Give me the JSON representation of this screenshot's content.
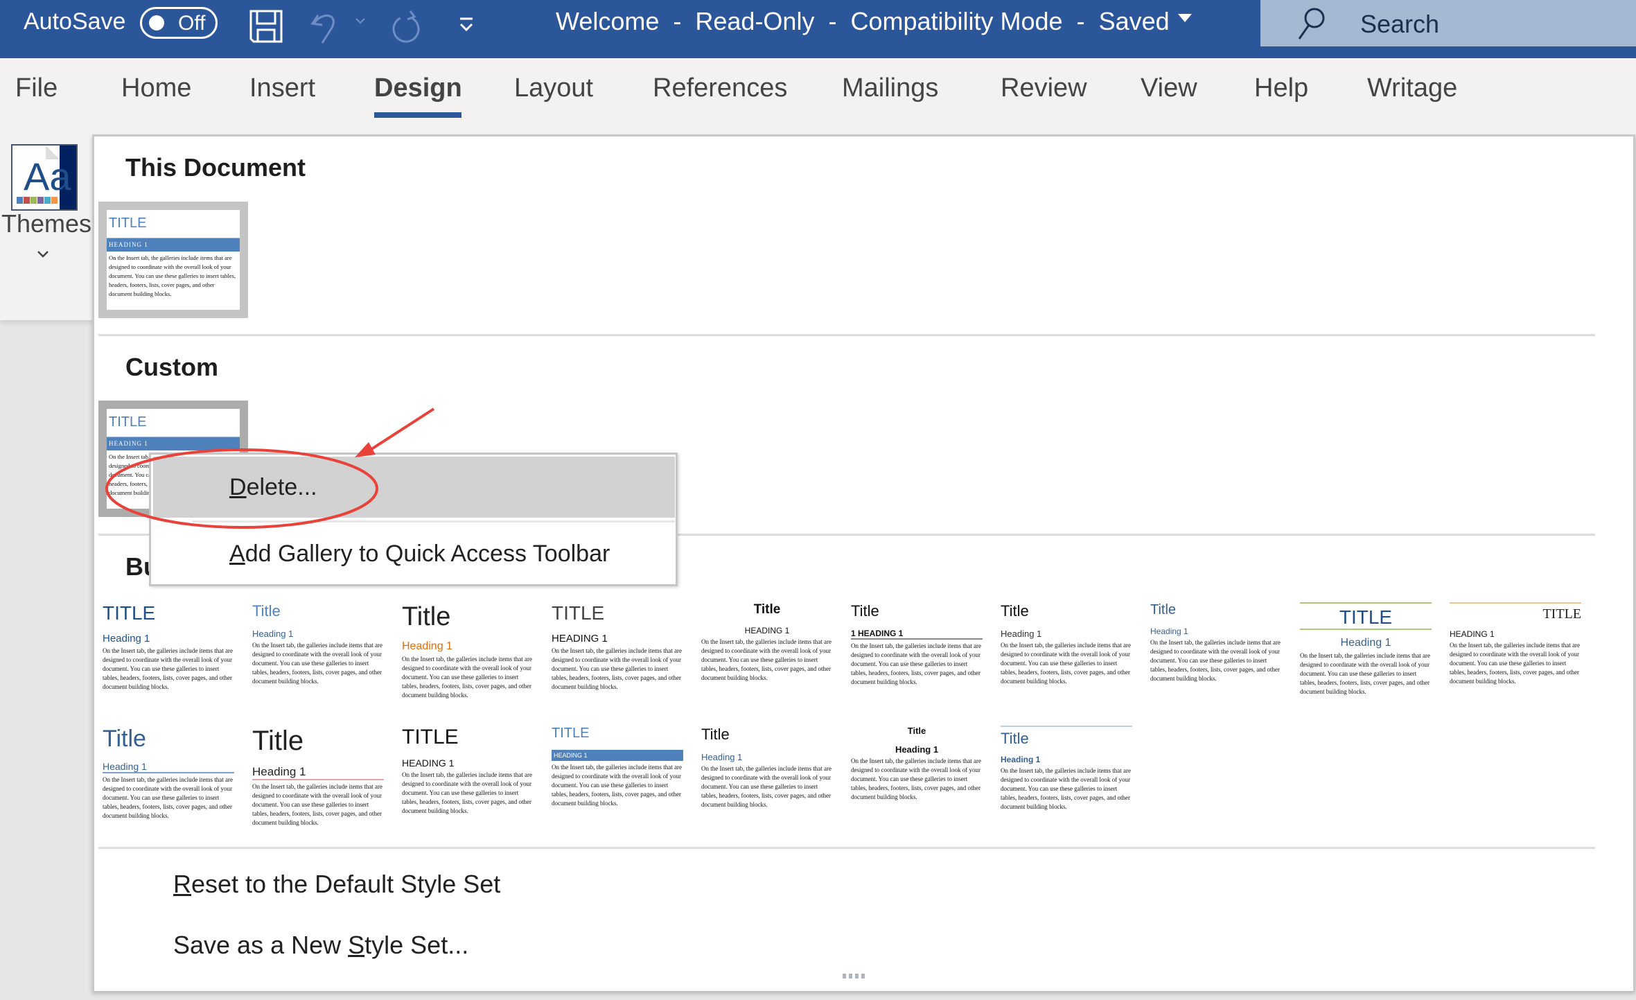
{
  "titlebar": {
    "autosave_label": "AutoSave",
    "autosave_state": "Off",
    "doc_title": "Welcome  -  Read-Only  -  Compatibility Mode  -  Saved",
    "search_placeholder": "Search",
    "colors": {
      "bar": "#2b579a",
      "search_bg": "#a6b9d3"
    }
  },
  "ribbon": {
    "tabs": [
      {
        "label": "File"
      },
      {
        "label": "Home"
      },
      {
        "label": "Insert"
      },
      {
        "label": "Design",
        "active": true
      },
      {
        "label": "Layout"
      },
      {
        "label": "References"
      },
      {
        "label": "Mailings"
      },
      {
        "label": "Review"
      },
      {
        "label": "View"
      },
      {
        "label": "Help"
      },
      {
        "label": "Writage"
      }
    ],
    "themes_label": "Themes",
    "theme_swatches": [
      "#4f81bd",
      "#c0504d",
      "#9bbb59",
      "#8064a2",
      "#4bacc6",
      "#f79646"
    ]
  },
  "gallery": {
    "this_document": {
      "title": "This Document",
      "thumb": {
        "title": "TITLE",
        "heading": "HEADING 1",
        "body": "On the Insert tab, the galleries include items that are designed to coordinate with the overall look of your document. You can use these galleries to insert tables, headers, footers, lists, cover pages, and other document building blocks."
      }
    },
    "custom": {
      "title": "Custom",
      "thumb": {
        "title": "TITLE",
        "heading": "HEADING 1",
        "body": "On the Insert tab, the galleries include items that are designed to coordinate with the overall look of your document. You can use these galleries to insert tables, headers, footers, lists, cover pages, and other document building blocks."
      }
    },
    "built_in": {
      "title": "Built-In",
      "body_text": "On the Insert tab, the galleries include items that are designed to coordinate with the overall look of your document. You can use these galleries to insert tables, headers, footers, lists, cover pages, and other document building blocks.",
      "row1": [
        {
          "title": "TITLE",
          "heading": "Heading 1"
        },
        {
          "title": "Title",
          "heading": "Heading 1"
        },
        {
          "title": "Title",
          "heading": "Heading 1"
        },
        {
          "title": "TITLE",
          "heading": "HEADING 1"
        },
        {
          "title": "Title",
          "heading": "HEADING 1"
        },
        {
          "title": "Title",
          "heading": "1   HEADING 1"
        },
        {
          "title": "Title",
          "heading": "Heading 1"
        },
        {
          "title": "Title",
          "heading": "Heading 1"
        },
        {
          "title": "TITLE",
          "heading": "Heading 1"
        },
        {
          "title": "TITLE",
          "heading": "HEADING 1"
        }
      ],
      "row2": [
        {
          "title": "Title",
          "heading": "Heading 1"
        },
        {
          "title": "Title",
          "heading": "Heading 1"
        },
        {
          "title": "TITLE",
          "heading": "HEADING 1"
        },
        {
          "title": "TITLE",
          "heading": "HEADING 1"
        },
        {
          "title": "Title",
          "heading": "Heading 1"
        },
        {
          "title": "Title",
          "heading": "Heading 1"
        },
        {
          "title": "Title",
          "heading": "Heading 1"
        }
      ]
    },
    "commands": {
      "reset": {
        "prefix": "",
        "accel": "R",
        "rest": "eset to the Default Style Set"
      },
      "save": {
        "prefix": "Save as a New ",
        "accel": "S",
        "rest": "tyle Set..."
      }
    }
  },
  "context_menu": {
    "items": [
      {
        "accel": "D",
        "rest": "elete...",
        "highlighted": true
      },
      {
        "accel": "A",
        "rest": "dd Gallery to Quick Access Toolbar",
        "highlighted": false
      }
    ]
  },
  "annotation": {
    "color": "#e8423a"
  }
}
